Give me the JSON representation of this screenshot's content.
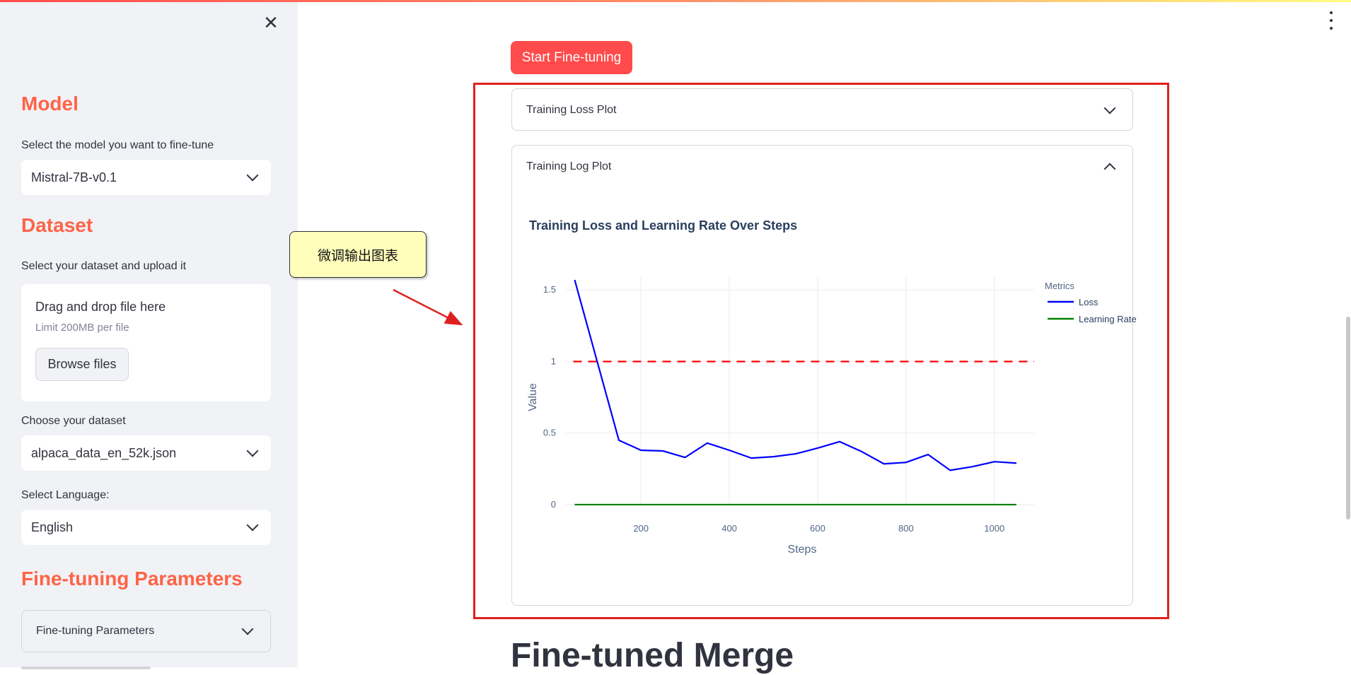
{
  "sidebar": {
    "model_heading": "Model",
    "model_label": "Select the model you want to fine-tune",
    "model_value": "Mistral-7B-v0.1",
    "dataset_heading": "Dataset",
    "upload_label": "Select your dataset and upload it",
    "upload_title": "Drag and drop file here",
    "upload_limit": "Limit 200MB per file",
    "browse_label": "Browse files",
    "choose_label": "Choose your dataset",
    "choose_value": "alpaca_data_en_52k.json",
    "language_label": "Select Language:",
    "language_value": "English",
    "params_heading": "Fine-tuning Parameters",
    "params_expander": "Fine-tuning Parameters"
  },
  "main": {
    "start_button": "Start Fine-tuning",
    "loss_plot_expander": "Training Loss Plot",
    "log_plot_expander": "Training Log Plot",
    "merge_heading": "Fine-tuned Merge"
  },
  "annotation": {
    "callout_text": "微调输出图表"
  },
  "colors": {
    "accent": "#ff4b4b",
    "heading": "#ff6347",
    "loss": "#0000ff",
    "learning_rate": "#008000",
    "threshold": "#ff0000",
    "annotation_border": "#e02020"
  },
  "chart_data": {
    "type": "line",
    "title": "Training Loss and Learning Rate Over Steps",
    "xlabel": "Steps",
    "ylabel": "Value",
    "legend_title": "Metrics",
    "legend_position": "top-right",
    "grid": true,
    "xlim": [
      30,
      1090
    ],
    "ylim": [
      -0.02,
      1.6
    ],
    "x_ticks": [
      200,
      400,
      600,
      800,
      1000
    ],
    "y_ticks": [
      0,
      0.5,
      1,
      1.5
    ],
    "y_tick_labels": [
      "0",
      "0.5",
      "1",
      "1.5"
    ],
    "threshold": {
      "y": 1,
      "style": "dashed",
      "color": "#ff0000"
    },
    "series": [
      {
        "name": "Loss",
        "color": "#0000ff",
        "x": [
          50,
          150,
          200,
          250,
          300,
          350,
          400,
          450,
          500,
          550,
          600,
          650,
          700,
          750,
          800,
          850,
          900,
          950,
          1000,
          1050
        ],
        "values": [
          1.57,
          0.45,
          0.38,
          0.375,
          0.33,
          0.43,
          0.38,
          0.325,
          0.335,
          0.355,
          0.395,
          0.44,
          0.37,
          0.285,
          0.295,
          0.35,
          0.24,
          0.265,
          0.3,
          0.29
        ]
      },
      {
        "name": "Learning Rate",
        "color": "#008000",
        "x": [
          50,
          1050
        ],
        "values": [
          2e-05,
          2e-05
        ]
      }
    ]
  }
}
